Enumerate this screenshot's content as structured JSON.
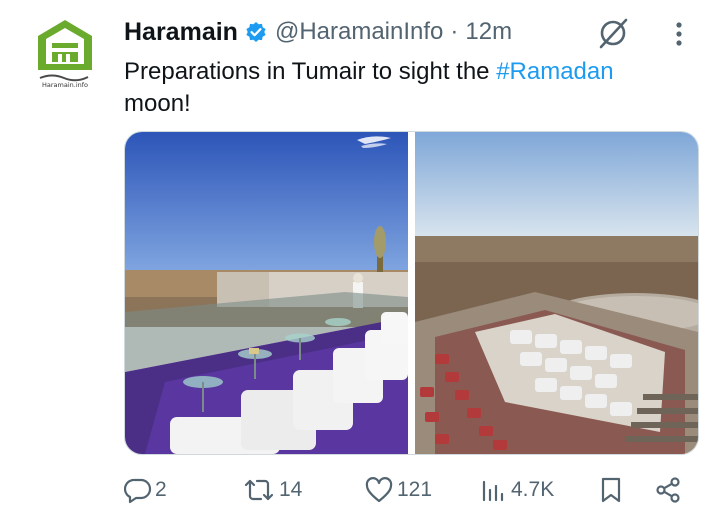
{
  "author": {
    "display_name": "Haramain",
    "handle": "@HaramainInfo",
    "separator": "·",
    "time": "12m",
    "avatar_caption": "Haramain.info"
  },
  "tweet": {
    "text_before": "Preparations in Tumair to sight the ",
    "hashtag": "#Ramadan",
    "text_after": " moon!"
  },
  "actions": {
    "replies": "2",
    "retweets": "14",
    "likes": "121",
    "views": "4.7K"
  },
  "icons": {
    "verified": "verified-badge-icon",
    "grok": "grok-icon",
    "more": "more-vertical-icon",
    "reply": "reply-icon",
    "retweet": "retweet-icon",
    "like": "heart-icon",
    "views": "views-chart-icon",
    "bookmark": "bookmark-icon",
    "share": "share-icon"
  },
  "colors": {
    "accent": "#1d9bf0",
    "muted": "#536471",
    "text": "#0f1419",
    "logo_green": "#6aab2e"
  }
}
